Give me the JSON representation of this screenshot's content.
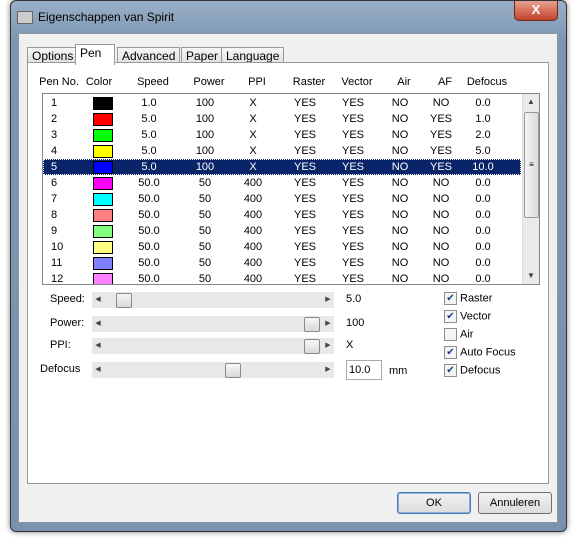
{
  "window": {
    "title": "Eigenschappen van Spirit",
    "close_label": "X"
  },
  "tabs": [
    {
      "label": "Options"
    },
    {
      "label": "Pen",
      "active": true
    },
    {
      "label": "Advanced"
    },
    {
      "label": "Paper"
    },
    {
      "label": "Language"
    }
  ],
  "columns": [
    "Pen No.",
    "Color",
    "Speed",
    "Power",
    "PPI",
    "Raster",
    "Vector",
    "Air",
    "AF",
    "Defocus"
  ],
  "pens": [
    {
      "no": "1",
      "color": "#000000",
      "speed": "1.0",
      "power": "100",
      "ppi": "X",
      "raster": "YES",
      "vector": "YES",
      "air": "NO",
      "af": "NO",
      "defocus": "0.0"
    },
    {
      "no": "2",
      "color": "#ff0000",
      "speed": "5.0",
      "power": "100",
      "ppi": "X",
      "raster": "YES",
      "vector": "YES",
      "air": "NO",
      "af": "YES",
      "defocus": "1.0"
    },
    {
      "no": "3",
      "color": "#00ff00",
      "speed": "5.0",
      "power": "100",
      "ppi": "X",
      "raster": "YES",
      "vector": "YES",
      "air": "NO",
      "af": "YES",
      "defocus": "2.0"
    },
    {
      "no": "4",
      "color": "#ffff00",
      "speed": "5.0",
      "power": "100",
      "ppi": "X",
      "raster": "YES",
      "vector": "YES",
      "air": "NO",
      "af": "YES",
      "defocus": "5.0"
    },
    {
      "no": "5",
      "color": "#0000ff",
      "speed": "5.0",
      "power": "100",
      "ppi": "X",
      "raster": "YES",
      "vector": "YES",
      "air": "NO",
      "af": "YES",
      "defocus": "10.0",
      "selected": true
    },
    {
      "no": "6",
      "color": "#ff00ff",
      "speed": "50.0",
      "power": "50",
      "ppi": "400",
      "raster": "YES",
      "vector": "YES",
      "air": "NO",
      "af": "NO",
      "defocus": "0.0"
    },
    {
      "no": "7",
      "color": "#00ffff",
      "speed": "50.0",
      "power": "50",
      "ppi": "400",
      "raster": "YES",
      "vector": "YES",
      "air": "NO",
      "af": "NO",
      "defocus": "0.0"
    },
    {
      "no": "8",
      "color": "#ff8080",
      "speed": "50.0",
      "power": "50",
      "ppi": "400",
      "raster": "YES",
      "vector": "YES",
      "air": "NO",
      "af": "NO",
      "defocus": "0.0"
    },
    {
      "no": "9",
      "color": "#80ff80",
      "speed": "50.0",
      "power": "50",
      "ppi": "400",
      "raster": "YES",
      "vector": "YES",
      "air": "NO",
      "af": "NO",
      "defocus": "0.0"
    },
    {
      "no": "10",
      "color": "#ffff80",
      "speed": "50.0",
      "power": "50",
      "ppi": "400",
      "raster": "YES",
      "vector": "YES",
      "air": "NO",
      "af": "NO",
      "defocus": "0.0"
    },
    {
      "no": "11",
      "color": "#8080ff",
      "speed": "50.0",
      "power": "50",
      "ppi": "400",
      "raster": "YES",
      "vector": "YES",
      "air": "NO",
      "af": "NO",
      "defocus": "0.0"
    },
    {
      "no": "12",
      "color": "#ff80ff",
      "speed": "50.0",
      "power": "50",
      "ppi": "400",
      "raster": "YES",
      "vector": "YES",
      "air": "NO",
      "af": "NO",
      "defocus": "0.0"
    }
  ],
  "controls": {
    "speed": {
      "label": "Speed:",
      "value": "5.0",
      "level": 0.05
    },
    "power": {
      "label": "Power:",
      "value": "100",
      "level": 1.0
    },
    "ppi": {
      "label": "PPI:",
      "value": "X",
      "level": 1.0
    },
    "defocus": {
      "label": "Defocus",
      "value": "10.0",
      "unit": "mm",
      "level": 0.6
    }
  },
  "checkboxes": [
    {
      "label": "Raster",
      "checked": true
    },
    {
      "label": "Vector",
      "checked": true
    },
    {
      "label": "Air",
      "checked": false
    },
    {
      "label": "Auto Focus",
      "checked": true
    },
    {
      "label": "Defocus",
      "checked": true
    }
  ],
  "buttons": {
    "ok": "OK",
    "cancel": "Annuleren"
  }
}
